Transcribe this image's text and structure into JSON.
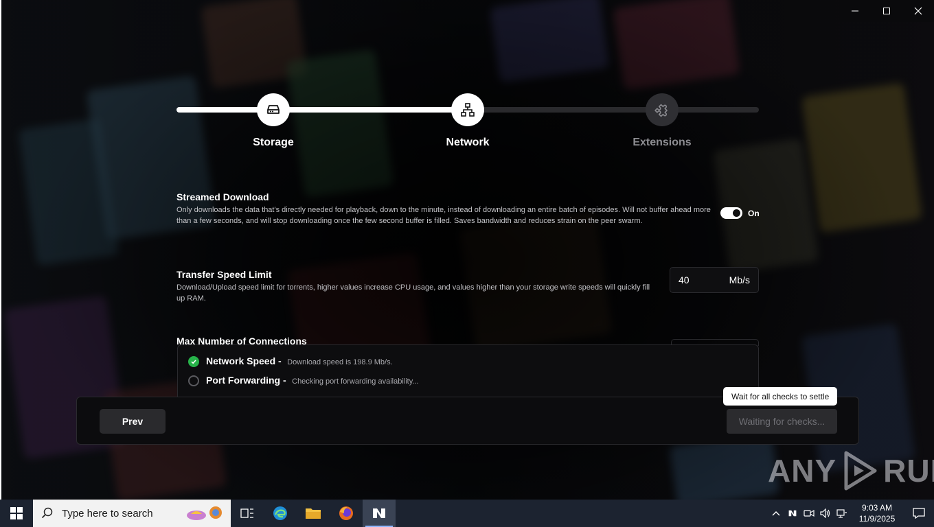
{
  "window": {
    "minimize_glyph": "—",
    "maximize_glyph": "☐",
    "close_glyph": "✕"
  },
  "stepper": {
    "steps": [
      {
        "label": "Storage",
        "icon": "hard-drive-icon",
        "state": "done"
      },
      {
        "label": "Network",
        "icon": "network-icon",
        "state": "current"
      },
      {
        "label": "Extensions",
        "icon": "puzzle-icon",
        "state": "todo"
      }
    ],
    "progress": 0.5
  },
  "settings": {
    "streamed_download": {
      "title": "Streamed Download",
      "description": "Only downloads the data that's directly needed for playback, down to the minute, instead of downloading an entire batch of episodes. Will not buffer ahead more than a few seconds, and will stop downloading once the few second buffer is filled. Saves bandwidth and reduces strain on the peer swarm.",
      "toggle_label": "On",
      "enabled": true
    },
    "transfer_speed": {
      "title": "Transfer Speed Limit",
      "description": "Download/Upload speed limit for torrents, higher values increase CPU usage, and values higher than your storage write speeds will quickly fill up RAM.",
      "value": "40",
      "unit": "Mb/s"
    },
    "max_connections": {
      "title": "Max Number of Connections"
    }
  },
  "checks": [
    {
      "name": "Network Speed -",
      "description": "Download speed is 198.9 Mb/s.",
      "status": "ok"
    },
    {
      "name": "Port Forwarding -",
      "description": "Checking port forwarding availability...",
      "status": "pending"
    }
  ],
  "footer": {
    "prev_label": "Prev",
    "next_label": "Waiting for checks...",
    "tooltip": "Wait for all checks to settle"
  },
  "watermark": {
    "left": "ANY",
    "right": "RUN"
  },
  "taskbar": {
    "search_placeholder": "Type here to search",
    "time": "9:03 AM",
    "date": "11/9/2025"
  },
  "colors": {
    "accent_ok": "#27b34a",
    "taskbar": "#1c2330"
  }
}
